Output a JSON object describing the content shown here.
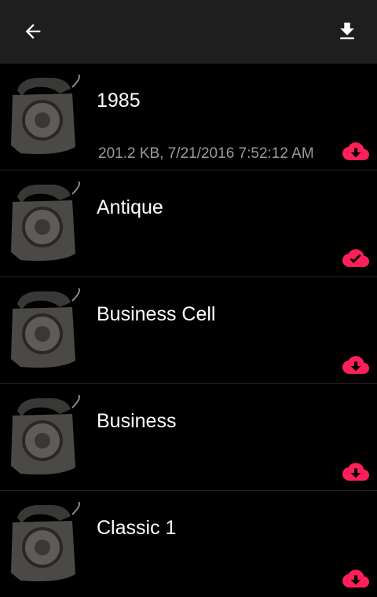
{
  "toolbar": {
    "back_icon": "arrow-left-icon",
    "action_icon": "download-icon"
  },
  "colors": {
    "accent": "#ff1f5a",
    "toolbar_bg": "#1e1e1e",
    "list_bg": "#000000",
    "meta_text": "#9a9a9a"
  },
  "ringtones": [
    {
      "title": "1985",
      "meta": "201.2 KB, 7/21/2016 7:52:12 AM",
      "status_icon": "cloud-download-icon"
    },
    {
      "title": "Antique",
      "meta": "",
      "status_icon": "cloud-done-icon"
    },
    {
      "title": "Business Cell",
      "meta": "",
      "status_icon": "cloud-download-icon"
    },
    {
      "title": "Business",
      "meta": "",
      "status_icon": "cloud-download-icon"
    },
    {
      "title": "Classic 1",
      "meta": "",
      "status_icon": "cloud-download-icon"
    }
  ]
}
